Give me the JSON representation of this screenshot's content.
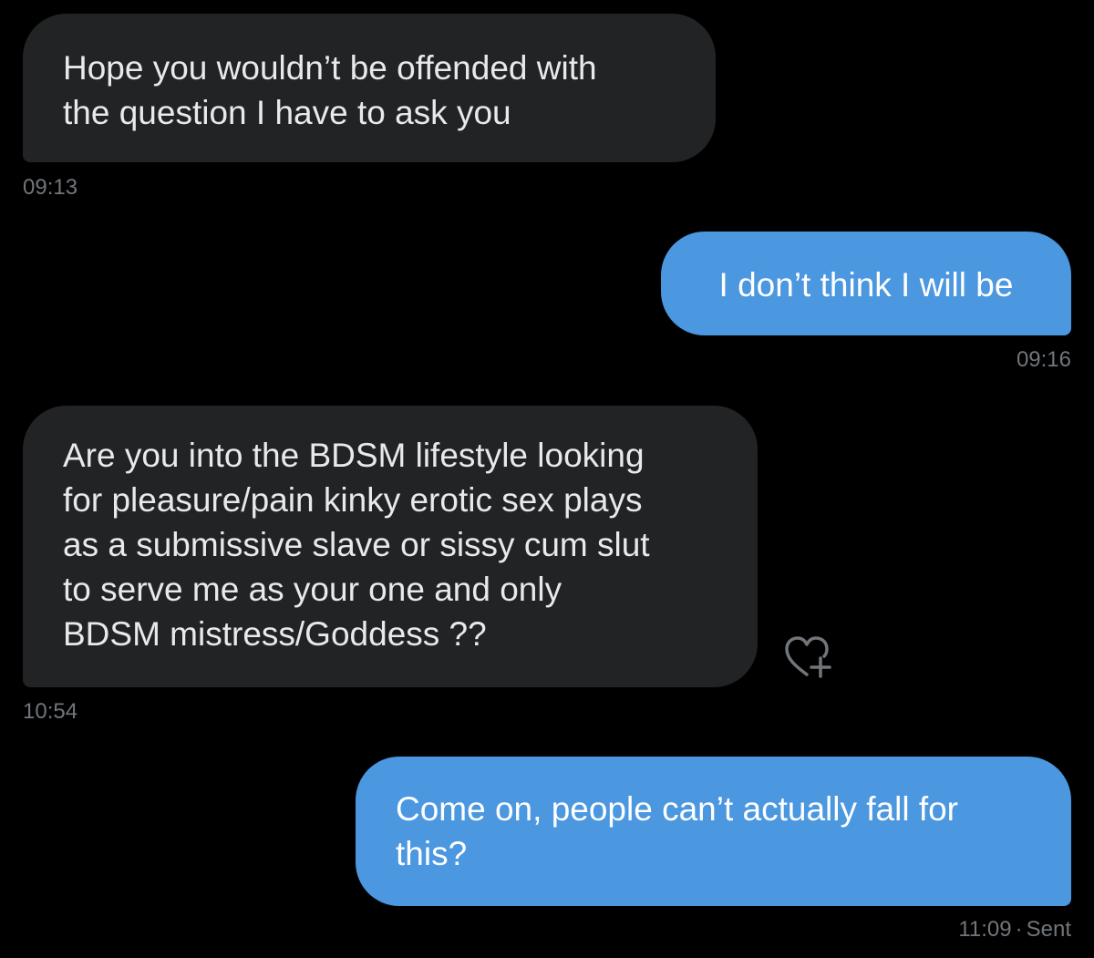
{
  "conversation": {
    "messages": [
      {
        "direction": "received",
        "text": "Hope you wouldn’t be offended with\nthe question I have to ask you",
        "time": "09:13"
      },
      {
        "direction": "sent",
        "text": "I don’t think I will be",
        "time": "09:16"
      },
      {
        "direction": "received",
        "text": "Are you into the BDSM lifestyle looking\nfor pleasure/pain kinky erotic sex plays\nas a submissive slave or sissy cum slut\nto serve me as your one and only\nBDSM mistress/Goddess ??",
        "time": "10:54"
      },
      {
        "direction": "sent",
        "text": "Come on, people can’t actually fall for\nthis?",
        "time": "11:09",
        "status_separator": "·",
        "status": "Sent"
      }
    ],
    "reaction_button_icon": "heart-plus-icon"
  },
  "colors": {
    "background": "#000000",
    "received_bubble": "#212325",
    "sent_bubble": "#4b97e0",
    "timestamp": "#71767b"
  }
}
